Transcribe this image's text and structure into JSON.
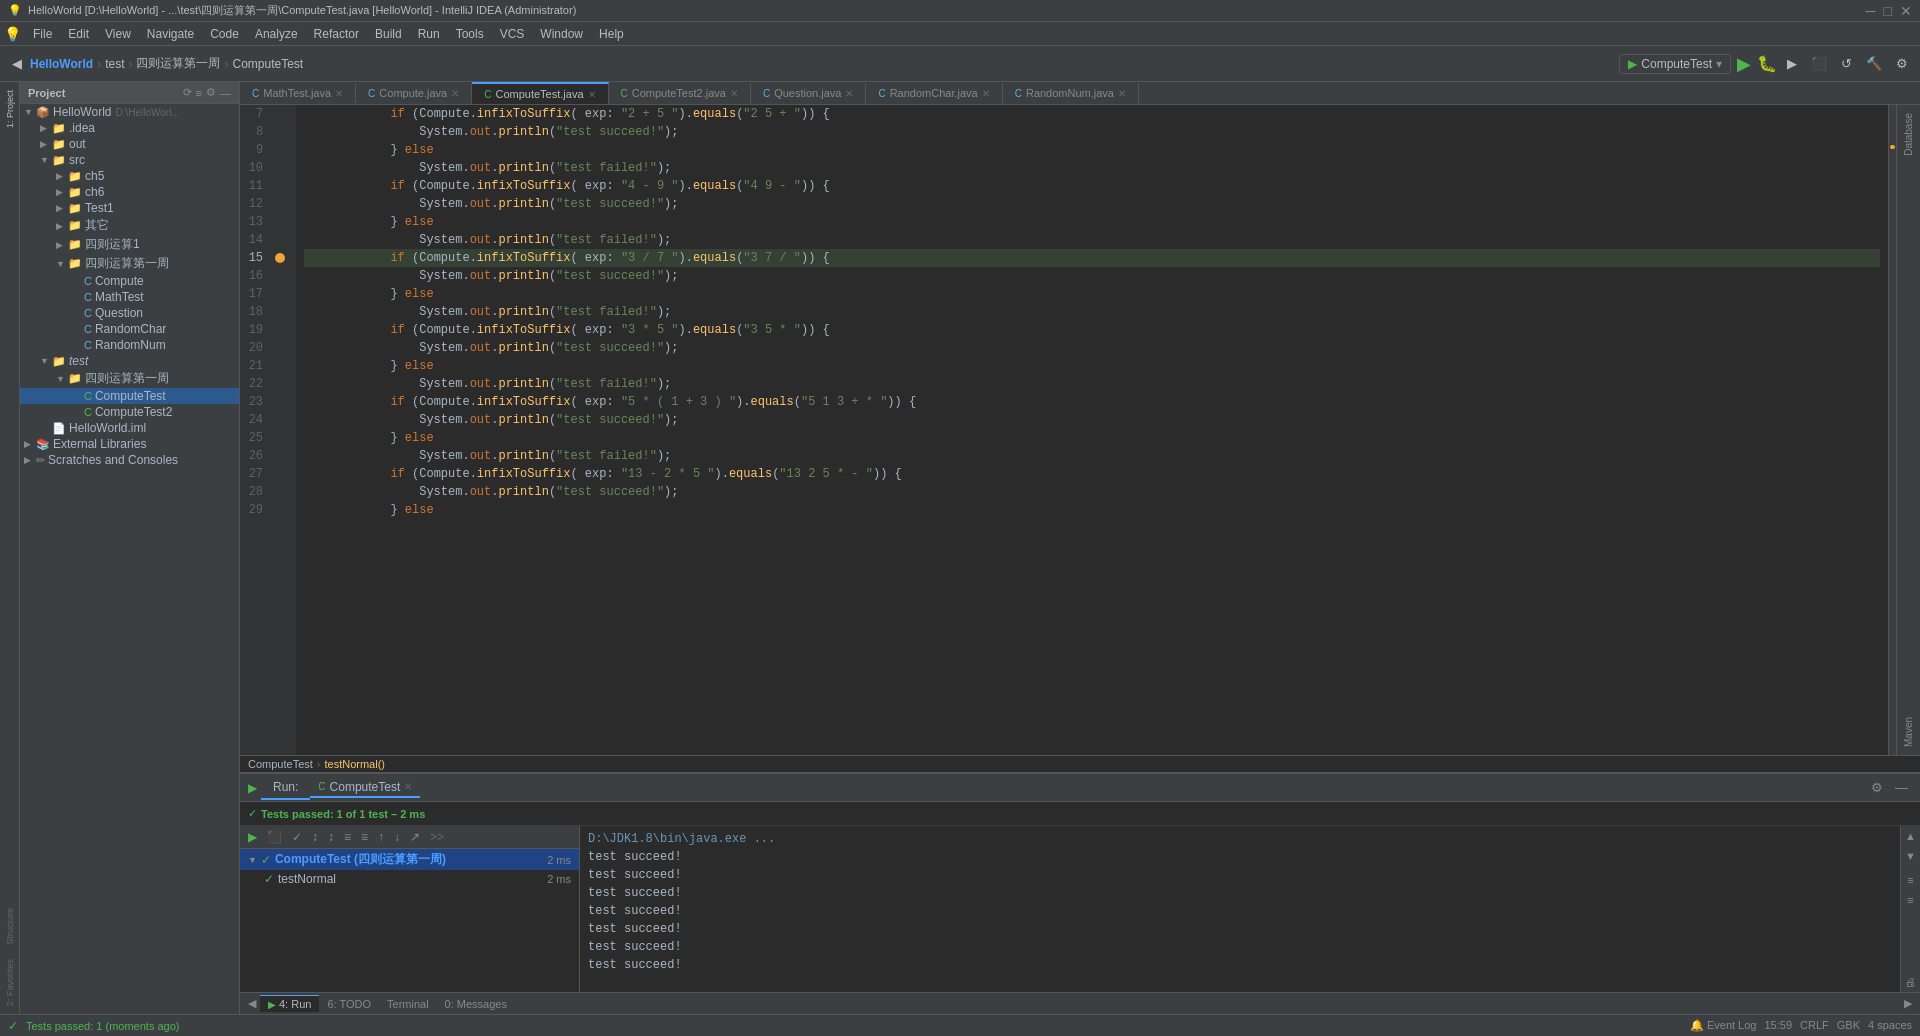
{
  "titleBar": {
    "text": "HelloWorld [D:\\HelloWorld] - ...\\test\\四则运算第一周\\ComputeTest.java [HelloWorld] - IntelliJ IDEA (Administrator)"
  },
  "menuBar": {
    "items": [
      "File",
      "Edit",
      "View",
      "Navigate",
      "Code",
      "Analyze",
      "Refactor",
      "Build",
      "Run",
      "Tools",
      "VCS",
      "Window",
      "Help"
    ]
  },
  "toolbar": {
    "projectName": "HelloWorld",
    "breadcrumb": [
      "test",
      "四则运算第一周",
      "ComputeTest"
    ],
    "runConfig": "ComputeTest"
  },
  "projectPanel": {
    "title": "Project",
    "tree": [
      {
        "id": "helloworld",
        "label": "HelloWorld",
        "path": "D:\\HelloWorld",
        "level": 0,
        "type": "module",
        "expanded": true
      },
      {
        "id": "idea",
        "label": ".idea",
        "level": 1,
        "type": "folder",
        "expanded": false
      },
      {
        "id": "out",
        "label": "out",
        "level": 1,
        "type": "folder-blue",
        "expanded": false
      },
      {
        "id": "src",
        "label": "src",
        "level": 1,
        "type": "folder-blue",
        "expanded": true
      },
      {
        "id": "ch5",
        "label": "ch5",
        "level": 2,
        "type": "folder-blue",
        "expanded": false
      },
      {
        "id": "ch6",
        "label": "ch6",
        "level": 2,
        "type": "folder-blue",
        "expanded": false
      },
      {
        "id": "test1",
        "label": "Test1",
        "level": 2,
        "type": "folder-blue",
        "expanded": false
      },
      {
        "id": "other",
        "label": "其它",
        "level": 2,
        "type": "folder-blue",
        "expanded": false
      },
      {
        "id": "siyun1",
        "label": "四则运算1",
        "level": 2,
        "type": "folder-blue",
        "expanded": false
      },
      {
        "id": "siyun-week",
        "label": "四则运算第一周",
        "level": 2,
        "type": "folder-blue",
        "expanded": true
      },
      {
        "id": "compute",
        "label": "Compute",
        "level": 3,
        "type": "java",
        "expanded": false
      },
      {
        "id": "mathtest",
        "label": "MathTest",
        "level": 3,
        "type": "java",
        "expanded": false
      },
      {
        "id": "question",
        "label": "Question",
        "level": 3,
        "type": "java",
        "expanded": false
      },
      {
        "id": "randomchar",
        "label": "RandomChar",
        "level": 3,
        "type": "java",
        "expanded": false
      },
      {
        "id": "randomnum",
        "label": "RandomNum",
        "level": 3,
        "type": "java",
        "expanded": false
      },
      {
        "id": "test",
        "label": "test",
        "level": 1,
        "type": "folder-blue",
        "expanded": true
      },
      {
        "id": "test-siyun",
        "label": "四则运算第一周",
        "level": 2,
        "type": "folder-blue",
        "expanded": true
      },
      {
        "id": "computetest",
        "label": "ComputeTest",
        "level": 3,
        "type": "java-test",
        "expanded": false
      },
      {
        "id": "computetest2",
        "label": "ComputeTest2",
        "level": 3,
        "type": "java-test",
        "expanded": false
      },
      {
        "id": "helloworld-iml",
        "label": "HelloWorld.iml",
        "level": 1,
        "type": "iml",
        "expanded": false
      },
      {
        "id": "ext-libs",
        "label": "External Libraries",
        "level": 0,
        "type": "folder",
        "expanded": false
      },
      {
        "id": "scratches",
        "label": "Scratches and Consoles",
        "level": 0,
        "type": "scratches",
        "expanded": false
      }
    ]
  },
  "tabs": [
    {
      "id": "mathtest",
      "label": "MathTest.java",
      "type": "java",
      "active": false,
      "closeable": true
    },
    {
      "id": "compute",
      "label": "Compute.java",
      "type": "java",
      "active": false,
      "closeable": true
    },
    {
      "id": "computetest",
      "label": "ComputeTest.java",
      "type": "test",
      "active": true,
      "closeable": true
    },
    {
      "id": "computetest2",
      "label": "ComputeTest2.java",
      "type": "test",
      "active": false,
      "closeable": true
    },
    {
      "id": "question",
      "label": "Question.java",
      "type": "java",
      "active": false,
      "closeable": true
    },
    {
      "id": "randomchar",
      "label": "RandomChar.java",
      "type": "java",
      "active": false,
      "closeable": true
    },
    {
      "id": "randomnum",
      "label": "RandomNum.java",
      "type": "java",
      "active": false,
      "closeable": true
    }
  ],
  "codeLines": [
    {
      "num": 7,
      "content": "            if (Compute.infixToSuffix( exp: \"2 + 5 \").equals(\"2 5 + \")) {",
      "highlight": false
    },
    {
      "num": 8,
      "content": "                System.out.println(\"test succeed!\");",
      "highlight": false
    },
    {
      "num": 9,
      "content": "            } else",
      "highlight": false
    },
    {
      "num": 10,
      "content": "                System.out.println(\"test failed!\");",
      "highlight": false
    },
    {
      "num": 11,
      "content": "            if (Compute.infixToSuffix( exp: \"4 - 9 \").equals(\"4 9 - \")) {",
      "highlight": false
    },
    {
      "num": 12,
      "content": "                System.out.println(\"test succeed!\");",
      "highlight": false
    },
    {
      "num": 13,
      "content": "            } else",
      "highlight": false
    },
    {
      "num": 14,
      "content": "                System.out.println(\"test failed!\");",
      "highlight": false
    },
    {
      "num": 15,
      "content": "            if (Compute.infixToSuffix( exp: \"3 / 7 \").equals(\"3 7 / \")) {",
      "highlight": true,
      "marker": true
    },
    {
      "num": 16,
      "content": "                System.out.println(\"test succeed!\");",
      "highlight": false
    },
    {
      "num": 17,
      "content": "            } else",
      "highlight": false
    },
    {
      "num": 18,
      "content": "                System.out.println(\"test failed!\");",
      "highlight": false
    },
    {
      "num": 19,
      "content": "            if (Compute.infixToSuffix( exp: \"3 * 5 \").equals(\"3 5 * \")) {",
      "highlight": false
    },
    {
      "num": 20,
      "content": "                System.out.println(\"test succeed!\");",
      "highlight": false
    },
    {
      "num": 21,
      "content": "            } else",
      "highlight": false
    },
    {
      "num": 22,
      "content": "                System.out.println(\"test failed!\");",
      "highlight": false
    },
    {
      "num": 23,
      "content": "            if (Compute.infixToSuffix( exp: \"5 * ( 1 + 3 ) \").equals(\"5 1 3 + * \")) {",
      "highlight": false
    },
    {
      "num": 24,
      "content": "                System.out.println(\"test succeed!\");",
      "highlight": false
    },
    {
      "num": 25,
      "content": "            } else",
      "highlight": false
    },
    {
      "num": 26,
      "content": "                System.out.println(\"test failed!\");",
      "highlight": false
    },
    {
      "num": 27,
      "content": "            if (Compute.infixToSuffix( exp: \"13 - 2 * 5 \").equals(\"13 2 5 * - \")) {",
      "highlight": false
    },
    {
      "num": 28,
      "content": "                System.out.println(\"test succeed!\");",
      "highlight": false
    },
    {
      "num": 29,
      "content": "            } else",
      "highlight": false
    }
  ],
  "breadcrumbBar": {
    "items": [
      "ComputeTest",
      "testNormal()"
    ]
  },
  "runPanel": {
    "tabLabel": "ComputeTest",
    "status": "Tests passed: 1 of 1 test – 2 ms",
    "treeItems": [
      {
        "id": "computetest-run",
        "label": "ComputeTest (四则运算第一周)",
        "time": "2 ms",
        "status": "pass",
        "level": 0,
        "expanded": true
      },
      {
        "id": "testnormal",
        "label": "testNormal",
        "time": "2 ms",
        "status": "pass",
        "level": 1
      }
    ],
    "consoleOutput": [
      "D:\\JDK1.8\\bin\\java.exe ...",
      "test succeed!",
      "test succeed!",
      "test succeed!",
      "test succeed!",
      "test succeed!",
      "test succeed!",
      "test succeed!"
    ]
  },
  "statusBar": {
    "left": "Tests passed: 1 (moments ago)",
    "line": "15:59",
    "encoding": "CRLF",
    "charset": "GBK",
    "indent": "4 spaces",
    "right": "Event Log"
  },
  "bottomTabs": [
    {
      "id": "run",
      "label": "4: Run",
      "icon": "▶"
    },
    {
      "id": "todo",
      "label": "6: TODO"
    },
    {
      "id": "terminal",
      "label": "Terminal"
    },
    {
      "id": "messages",
      "label": "0: Messages"
    }
  ],
  "rightSidebarLabels": [
    "Database",
    "Maven"
  ],
  "activityBarLabels": [
    "1: Project",
    "2: Favorites",
    "Structure",
    "Z-Structure"
  ]
}
